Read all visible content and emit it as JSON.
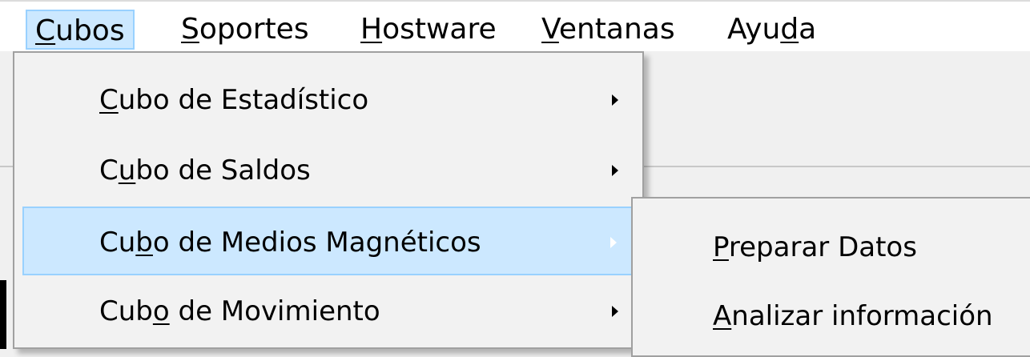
{
  "menubar": {
    "items": [
      {
        "pre": "",
        "key": "C",
        "post": "ubos"
      },
      {
        "pre": "",
        "key": "S",
        "post": "oportes"
      },
      {
        "pre": "",
        "key": "H",
        "post": "ostware"
      },
      {
        "pre": "",
        "key": "V",
        "post": "entanas"
      },
      {
        "pre": "Ayu",
        "key": "d",
        "post": "a"
      }
    ]
  },
  "cubos_menu": {
    "items": [
      {
        "pre": "",
        "key": "C",
        "post": "ubo de Estadístico"
      },
      {
        "pre": "C",
        "key": "u",
        "post": "bo de Saldos"
      },
      {
        "pre": "Cu",
        "key": "b",
        "post": "o de Medios Magnéticos"
      },
      {
        "pre": "Cub",
        "key": "o",
        "post": " de Movimiento"
      }
    ]
  },
  "medios_submenu": {
    "items": [
      {
        "pre": "",
        "key": "P",
        "post": "reparar Datos"
      },
      {
        "pre": "",
        "key": "A",
        "post": "nalizar información"
      }
    ]
  },
  "colors": {
    "highlight_fill": "#cce8ff",
    "highlight_border": "#99d1ff",
    "menu_bg": "#f2f2f2"
  }
}
